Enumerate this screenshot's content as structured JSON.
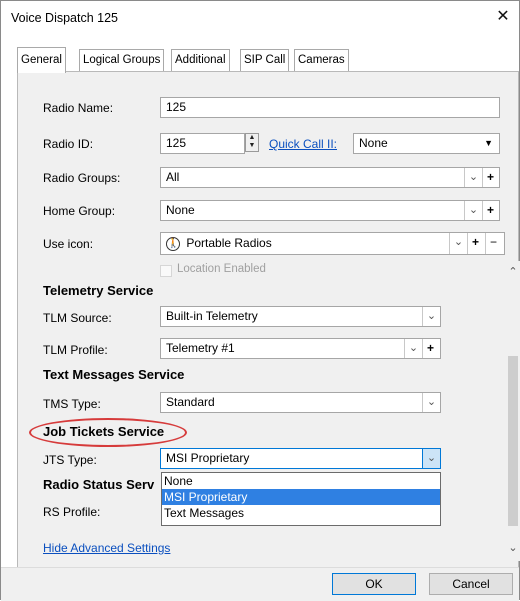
{
  "window": {
    "title": "Voice Dispatch 125",
    "close_glyph": "✕"
  },
  "tabs": [
    {
      "label": "General"
    },
    {
      "label": "Logical Groups"
    },
    {
      "label": "Additional"
    },
    {
      "label": "SIP Call"
    },
    {
      "label": "Cameras"
    }
  ],
  "active_tab": "General",
  "fields": {
    "radio_name": {
      "label": "Radio Name:",
      "value": "125"
    },
    "radio_id": {
      "label": "Radio ID:",
      "value": "125"
    },
    "quick_call": {
      "label": "Quick Call II:",
      "value": "None"
    },
    "radio_groups": {
      "label": "Radio Groups:",
      "value": "All"
    },
    "home_group": {
      "label": "Home Group:",
      "value": "None"
    },
    "use_icon": {
      "label": "Use icon:",
      "value": "Portable Radios"
    }
  },
  "location_enabled": {
    "label": "Location Enabled"
  },
  "sections": {
    "telemetry": {
      "title": "Telemetry Service",
      "tlm_source": {
        "label": "TLM Source:",
        "value": "Built-in Telemetry"
      },
      "tlm_profile": {
        "label": "TLM Profile:",
        "value": "Telemetry #1"
      }
    },
    "text_messages": {
      "title": "Text Messages Service",
      "tms_type": {
        "label": "TMS Type:",
        "value": "Standard"
      }
    },
    "job_tickets": {
      "title": "Job Tickets Service",
      "jts_type": {
        "label": "JTS Type:",
        "value": "MSI Proprietary"
      },
      "jts_options": [
        "None",
        "MSI Proprietary",
        "Text Messages"
      ],
      "jts_selected_index": 1
    },
    "radio_status": {
      "title": "Radio Status Serv",
      "rs_profile": {
        "label": "RS Profile:"
      }
    }
  },
  "hide_advanced_link": "Hide Advanced Settings",
  "buttons": {
    "ok": "OK",
    "cancel": "Cancel"
  },
  "colors": {
    "link": "#0a4fbf",
    "selection": "#2f80e2",
    "highlight_ellipse": "#d63b3b"
  }
}
